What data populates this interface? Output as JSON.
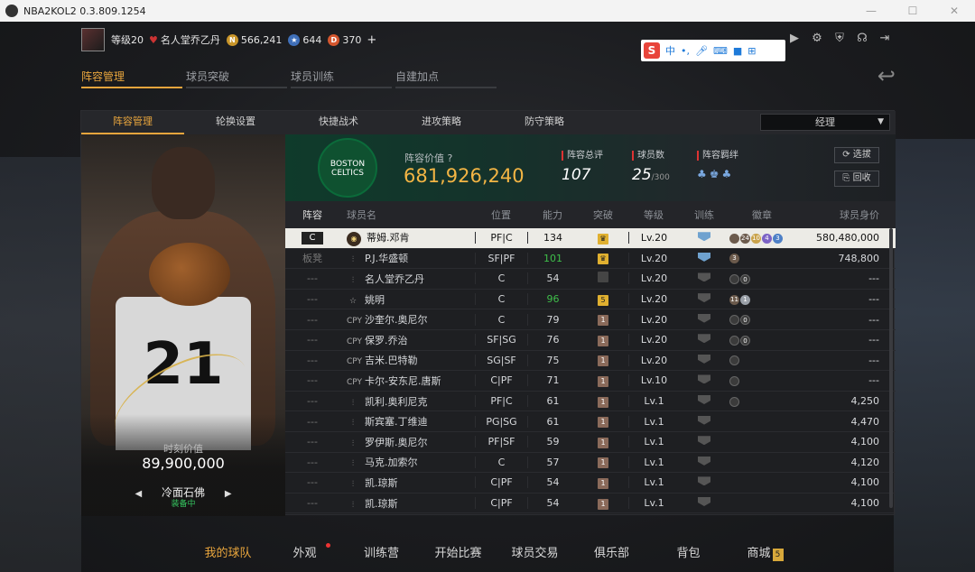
{
  "window": {
    "title": "NBA2KOL2 0.3.809.1254"
  },
  "player": {
    "level": "等级20",
    "hof_title": "名人堂乔乙丹",
    "gold": "566,241",
    "stars": "644",
    "points": "370",
    "plus": "+"
  },
  "ime": {
    "label": "中",
    "logo": "S"
  },
  "main_tabs": [
    "阵容管理",
    "球员突破",
    "球员训练",
    "自建加点"
  ],
  "sub_tabs": [
    "阵容管理",
    "轮换设置",
    "快捷战术",
    "进攻策略",
    "防守策略"
  ],
  "mode_select": {
    "value": "经理"
  },
  "card": {
    "jersey_number": "21",
    "value_label": "时刻价值",
    "value": "89,900,000",
    "skill": "冷面石佛",
    "status": "装备中"
  },
  "team": {
    "logo_text": "BOSTON CELTICS",
    "value_label": "阵容价值",
    "value": "681,926,240",
    "rating_label": "阵容总评",
    "rating": "107",
    "count_label": "球员数",
    "count": "25",
    "count_max": "/300",
    "chem_label": "阵容羁绊",
    "select_label": "选拔",
    "recycle_label": "回收"
  },
  "columns": [
    "阵容",
    "球员名",
    "位置",
    "能力",
    "突破",
    "等级",
    "训练",
    "徽章",
    "球员身价"
  ],
  "rows": [
    {
      "role": "C",
      "name": "蒂姆.邓肯",
      "pos": "PF|C",
      "ovr": "134",
      "brk": "♛",
      "lvl": "Lv.20",
      "worth": "580,480,000"
    },
    {
      "role": "板凳",
      "name": "P.J.华盛顿",
      "pos": "SF|PF",
      "ovr": "101",
      "brk": "♛",
      "lvl": "Lv.20",
      "worth": "748,800"
    },
    {
      "role": "---",
      "name": "名人堂乔乙丹",
      "pos": "C",
      "ovr": "54",
      "brk": "",
      "lvl": "Lv.20",
      "worth": "---"
    },
    {
      "role": "---",
      "name": "姚明",
      "pos": "C",
      "ovr": "96",
      "brk": "5",
      "lvl": "Lv.20",
      "worth": "---"
    },
    {
      "role": "---",
      "name": "沙奎尔.奥尼尔",
      "pos": "C",
      "ovr": "79",
      "brk": "1",
      "lvl": "Lv.20",
      "worth": "---"
    },
    {
      "role": "---",
      "name": "保罗.乔治",
      "pos": "SF|SG",
      "ovr": "76",
      "brk": "1",
      "lvl": "Lv.20",
      "worth": "---"
    },
    {
      "role": "---",
      "name": "吉米.巴特勒",
      "pos": "SG|SF",
      "ovr": "75",
      "brk": "1",
      "lvl": "Lv.20",
      "worth": "---"
    },
    {
      "role": "---",
      "name": "卡尔-安东尼.唐斯",
      "pos": "C|PF",
      "ovr": "71",
      "brk": "1",
      "lvl": "Lv.10",
      "worth": "---"
    },
    {
      "role": "---",
      "name": "凯利.奥利尼克",
      "pos": "PF|C",
      "ovr": "61",
      "brk": "1",
      "lvl": "Lv.1",
      "worth": "4,250"
    },
    {
      "role": "---",
      "name": "斯宾塞.丁维迪",
      "pos": "PG|SG",
      "ovr": "61",
      "brk": "1",
      "lvl": "Lv.1",
      "worth": "4,470"
    },
    {
      "role": "---",
      "name": "罗伊斯.奥尼尔",
      "pos": "PF|SF",
      "ovr": "59",
      "brk": "1",
      "lvl": "Lv.1",
      "worth": "4,100"
    },
    {
      "role": "---",
      "name": "马克.加索尔",
      "pos": "C",
      "ovr": "57",
      "brk": "1",
      "lvl": "Lv.1",
      "worth": "4,120"
    },
    {
      "role": "---",
      "name": "凯.琼斯",
      "pos": "C|PF",
      "ovr": "54",
      "brk": "1",
      "lvl": "Lv.1",
      "worth": "4,100"
    },
    {
      "role": "---",
      "name": "凯.琼斯",
      "pos": "C|PF",
      "ovr": "54",
      "brk": "1",
      "lvl": "Lv.1",
      "worth": "4,100"
    }
  ],
  "bottom_nav": [
    "我的球队",
    "外观",
    "训练营",
    "开始比赛",
    "球员交易",
    "俱乐部",
    "背包",
    "商城"
  ],
  "shop_badge": "5",
  "badges_row0": [
    "0",
    "24",
    "10",
    "4",
    "3"
  ],
  "colors": {
    "accent": "#e8a53d",
    "selected_row": "#ecebe6",
    "value_gold": "#f3b544"
  }
}
